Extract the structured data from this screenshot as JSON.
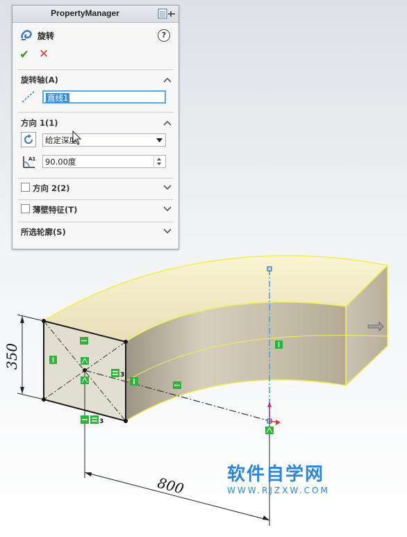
{
  "property_manager": {
    "title": "PropertyManager",
    "feature_name": "旋转",
    "help_symbol": "?",
    "ok_symbol": "✔",
    "cancel_symbol": "✕",
    "sections": {
      "axis": {
        "title": "旋转轴(A)",
        "value": "直线1"
      },
      "direction1": {
        "title": "方向 1(1)",
        "end_condition": "给定深度",
        "angle": "90.00度"
      },
      "direction2": {
        "title": "方向 2(2)",
        "checked": false
      },
      "thin": {
        "title": "薄壁特征(T)",
        "checked": false
      },
      "contours": {
        "title": "所选轮廓(S)"
      }
    }
  },
  "viewport": {
    "dimensions": {
      "height": "350",
      "width": "800"
    },
    "relation_labels": [
      "3",
      "3"
    ],
    "colors": {
      "face_top": "#f1e7b8",
      "face_side": "#d6cfbd",
      "highlight": "#f1f060",
      "axis": "#42a6e3",
      "relation_green": "#2db23a"
    }
  },
  "watermark": {
    "text": "软件自学网",
    "url": "WWW.RJZXW.COM"
  }
}
